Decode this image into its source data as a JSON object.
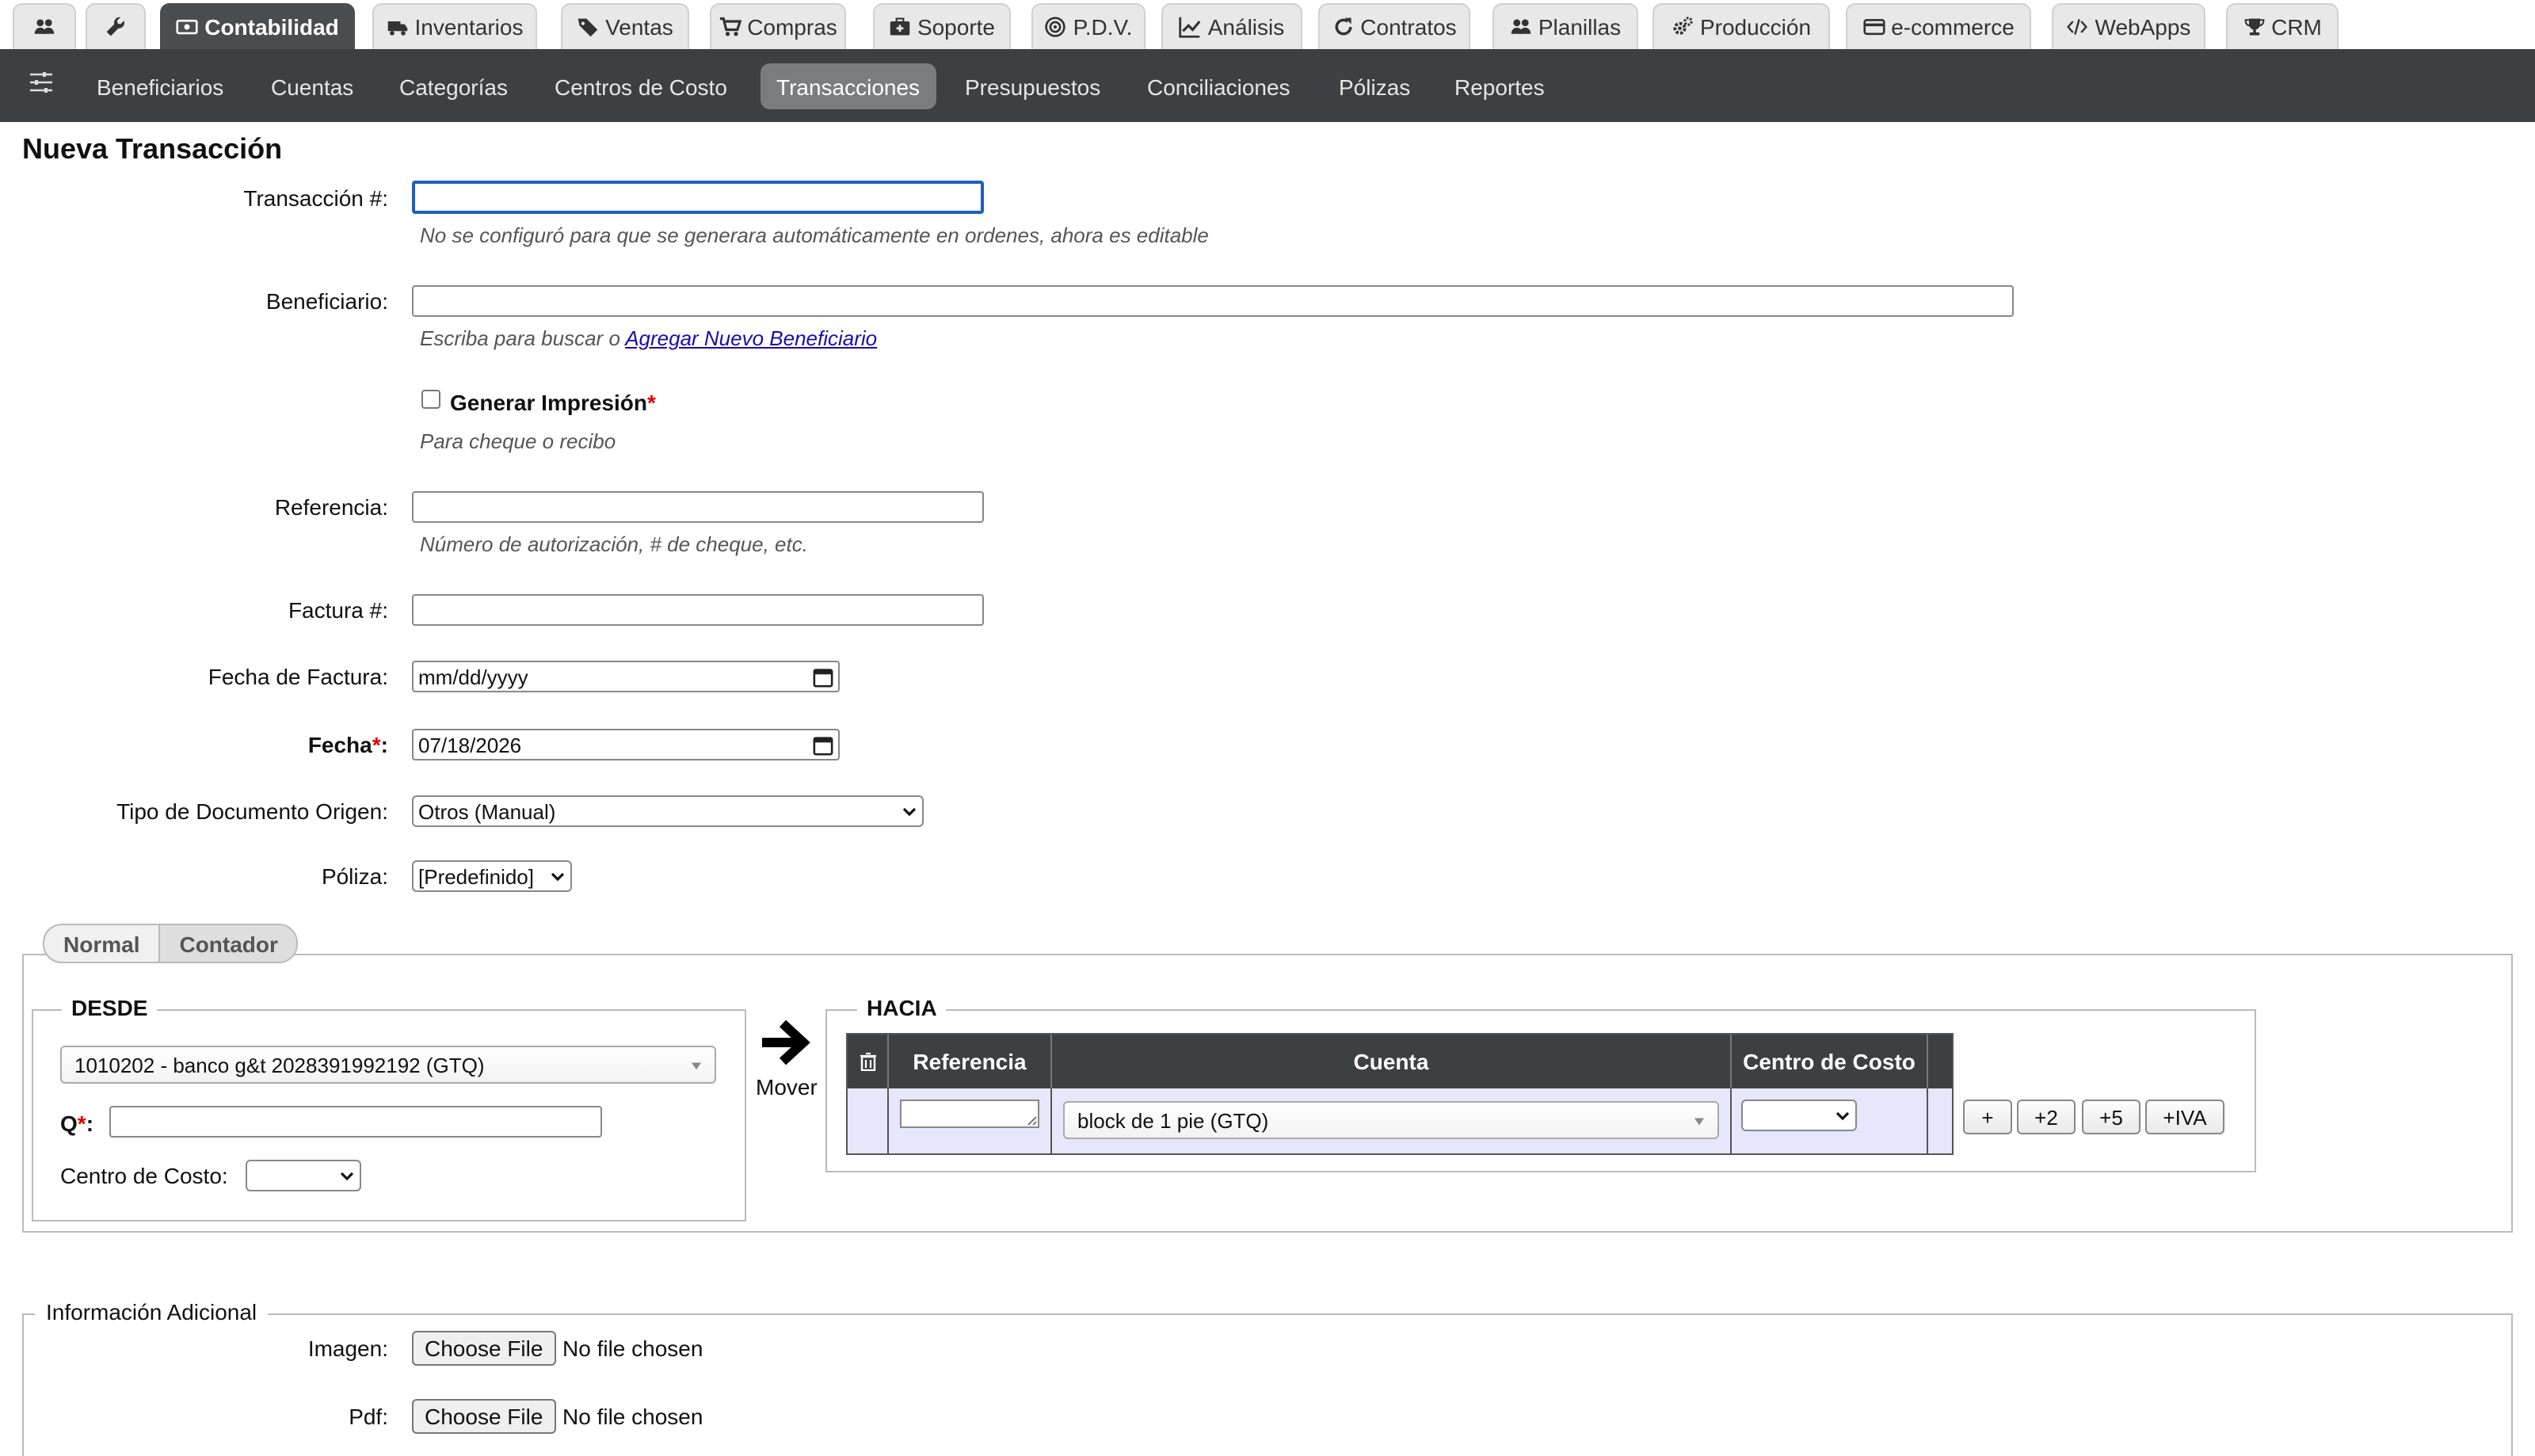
{
  "modules": [
    {
      "label": "",
      "icon": "users-icon"
    },
    {
      "label": "",
      "icon": "wrench-icon"
    },
    {
      "label": "Contabilidad",
      "icon": "money-icon",
      "active": true
    },
    {
      "label": "Inventarios",
      "icon": "truck-icon"
    },
    {
      "label": "Ventas",
      "icon": "tags-icon"
    },
    {
      "label": "Compras",
      "icon": "cart-icon"
    },
    {
      "label": "Soporte",
      "icon": "medkit-icon"
    },
    {
      "label": "P.D.V.",
      "icon": "target-icon"
    },
    {
      "label": "Análisis",
      "icon": "chart-line-icon"
    },
    {
      "label": "Contratos",
      "icon": "refresh-icon"
    },
    {
      "label": "Planillas",
      "icon": "users-icon"
    },
    {
      "label": "Producción",
      "icon": "gears-icon"
    },
    {
      "label": "e-commerce",
      "icon": "credit-card-icon"
    },
    {
      "label": "WebApps",
      "icon": "code-icon"
    },
    {
      "label": "CRM",
      "icon": "trophy-icon"
    }
  ],
  "submenu": {
    "icon": "sliders-icon",
    "items": [
      "Beneficiarios",
      "Cuentas",
      "Categorías",
      "Centros de Costo",
      "Transacciones",
      "Presupuestos",
      "Conciliaciones",
      "Pólizas",
      "Reportes"
    ],
    "active": "Transacciones"
  },
  "page": {
    "title": "Nueva Transacción"
  },
  "form": {
    "transaccion_label": "Transacción #:",
    "transaccion_value": "",
    "transaccion_help": "No se configuró para que se generara automáticamente en ordenes, ahora es editable",
    "beneficiario_label": "Beneficiario:",
    "beneficiario_value": "",
    "beneficiario_help": "Escriba para buscar o",
    "beneficiario_link": "Agregar Nuevo Beneficiario",
    "imprimir_label": "Generar Impresión",
    "imprimir_req": "*",
    "imprimir_help": "Para cheque o recibo",
    "referencia_label": "Referencia:",
    "referencia_value": "",
    "referencia_help": "Número de autorización, # de cheque, etc.",
    "factura_label": "Factura #:",
    "factura_value": "",
    "fecha_factura_label": "Fecha de Factura:",
    "fecha_factura_value": "mm/dd/yyyy",
    "fecha_label": "Fecha",
    "fecha_req": "*",
    "fecha_colon": ":",
    "fecha_value": "07/18/2026",
    "tipo_doc_label": "Tipo de Documento Origen:",
    "tipo_doc_value": "Otros (Manual)",
    "poliza_label": "Póliza:",
    "poliza_value": "[Predefinido]"
  },
  "mode_tabs": [
    "Normal",
    "Contador"
  ],
  "desde": {
    "legend": "DESDE",
    "cuenta": "1010202 - banco g&t 2028391992192 (GTQ)",
    "q_label": "Q",
    "q_req": "*",
    "q_colon": ":",
    "q_value": "",
    "centro_label": "Centro de Costo:",
    "centro_value": ""
  },
  "mover_label": "Mover",
  "hacia": {
    "legend": "HACIA",
    "columns": [
      "Referencia",
      "Cuenta",
      "Centro de Costo"
    ],
    "row": {
      "referencia": "",
      "cuenta": "block de 1 pie (GTQ)",
      "centro": ""
    },
    "buttons": [
      "+",
      "+2",
      "+5",
      "+IVA"
    ]
  },
  "info": {
    "legend": "Información Adicional",
    "imagen_label": "Imagen:",
    "pdf_label": "Pdf:",
    "choose_file": "Choose File",
    "no_file": "No file chosen"
  }
}
